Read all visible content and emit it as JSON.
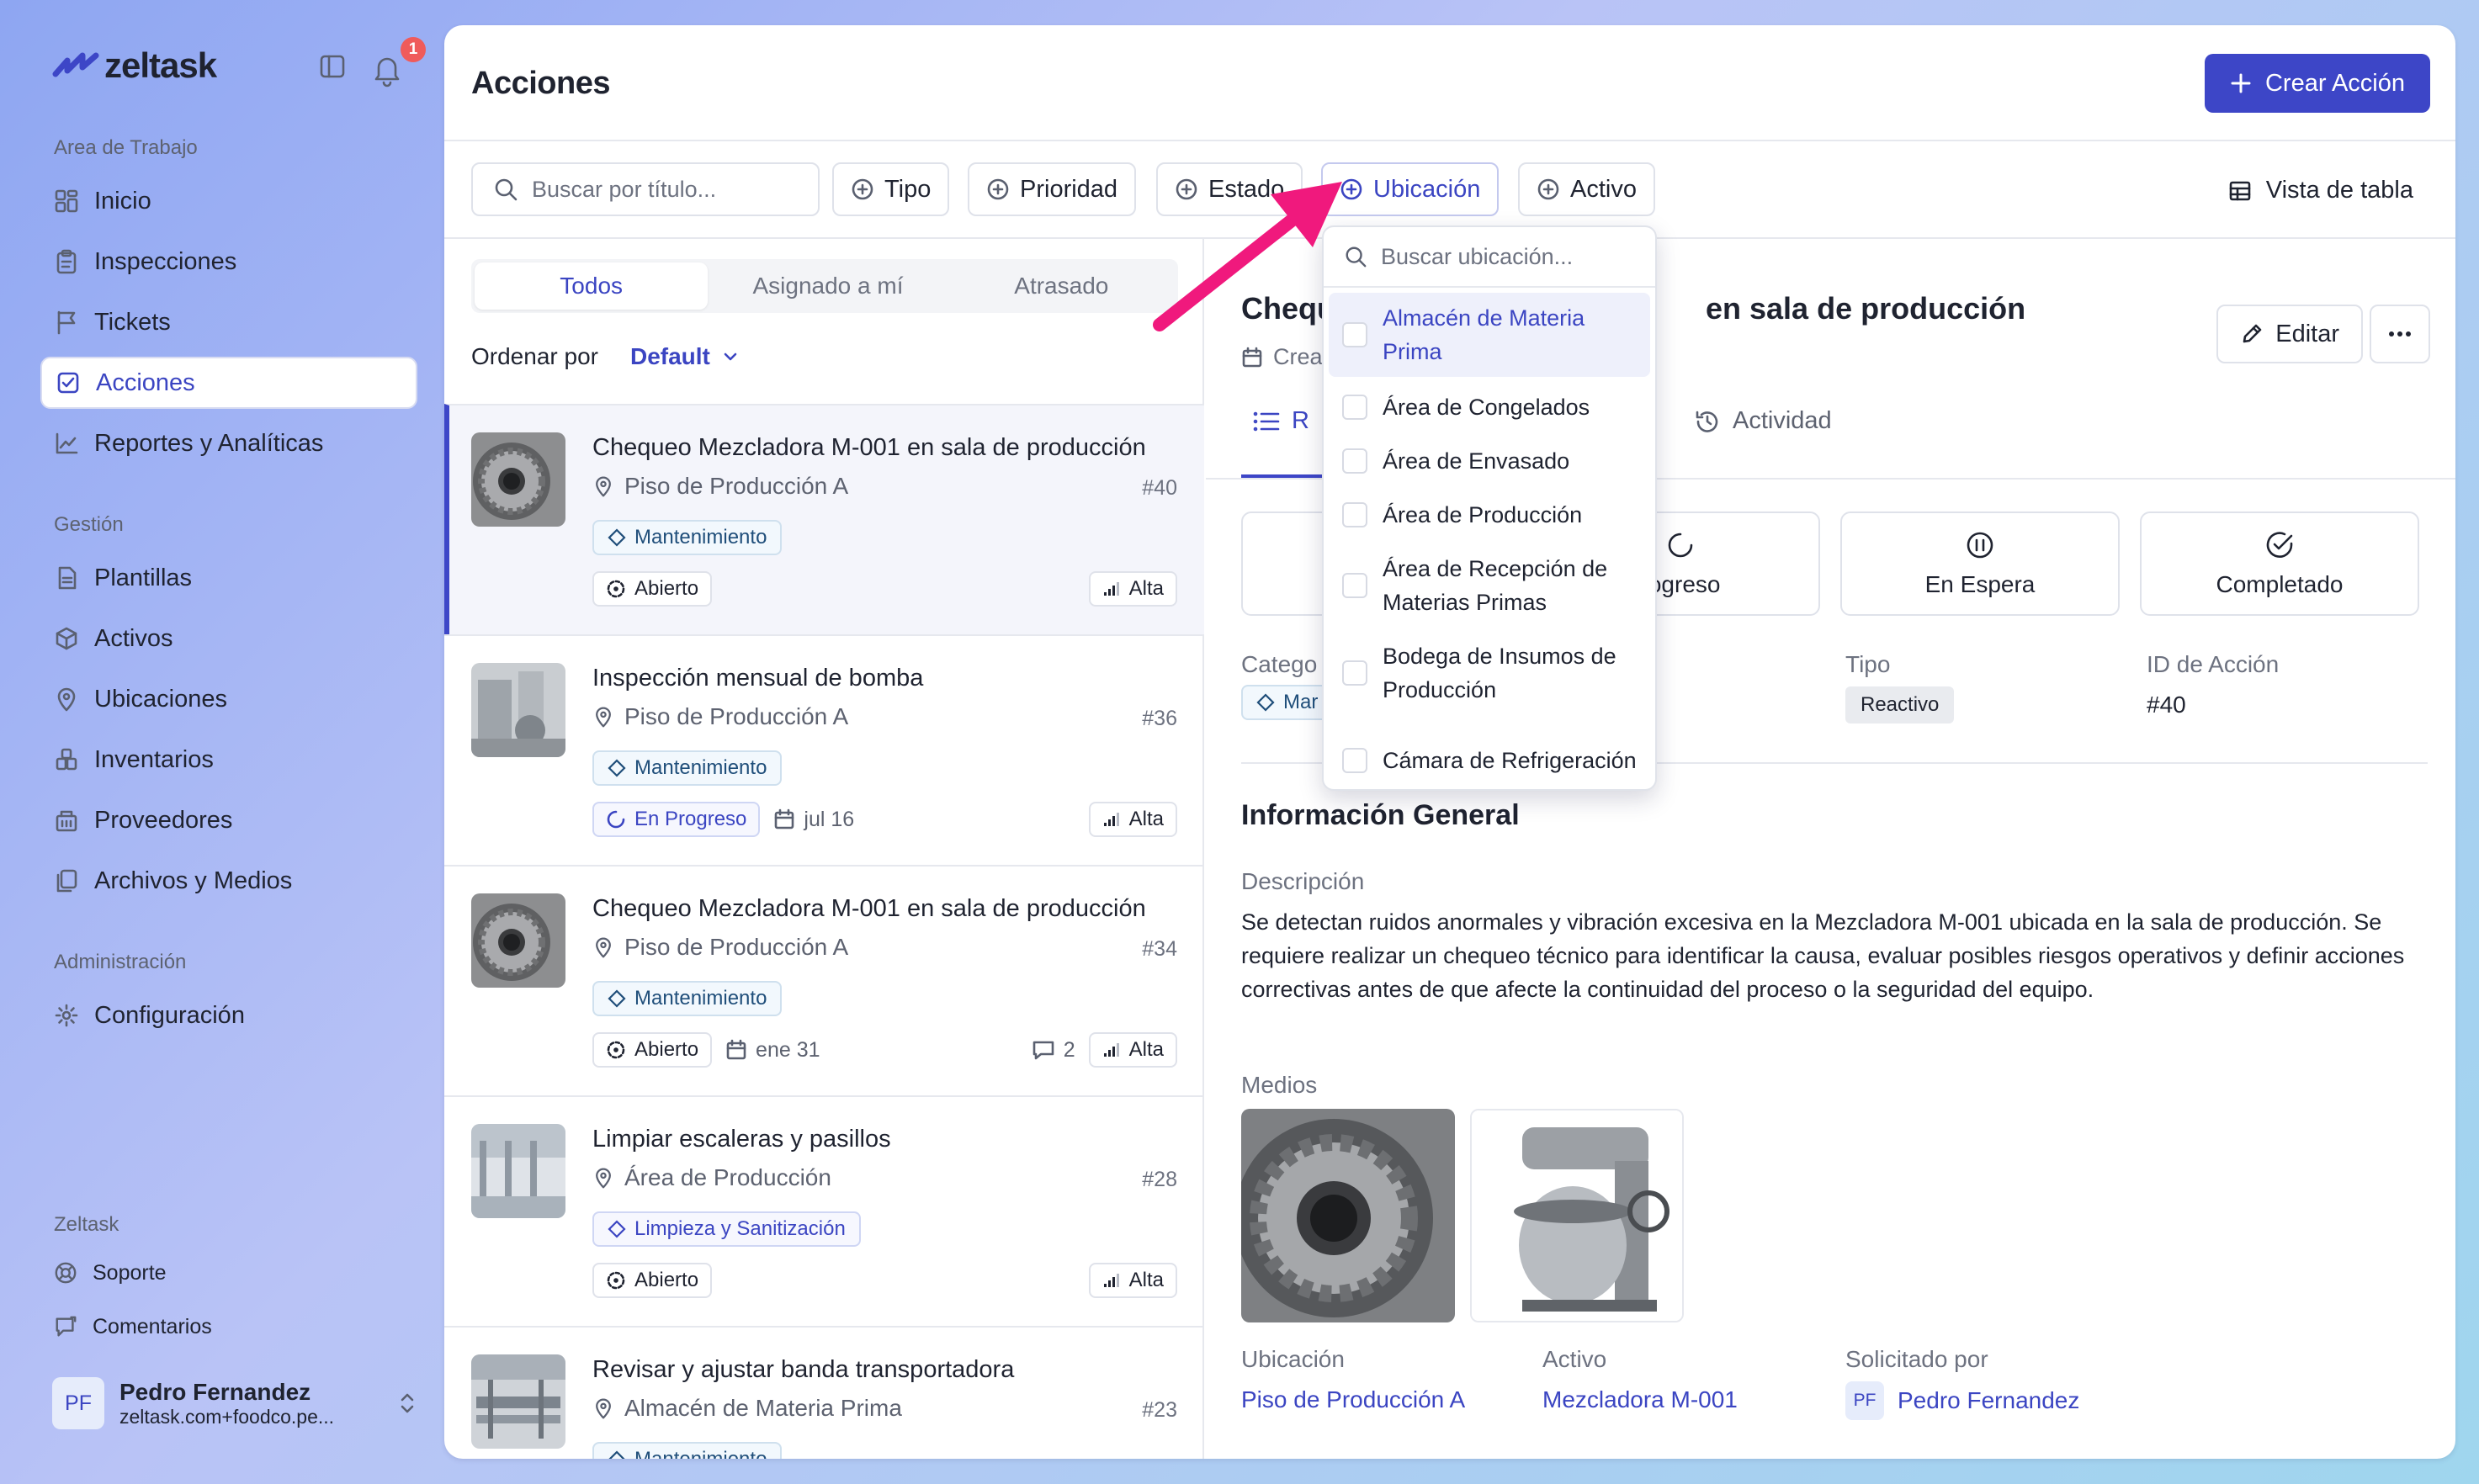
{
  "brand": {
    "name": "zeltask",
    "accent": "#3d46c7",
    "notif_count": "1"
  },
  "sidebar": {
    "section_workspace": "Area de Trabajo",
    "workspace_items": [
      {
        "label": "Inicio",
        "icon": "dashboard-icon"
      },
      {
        "label": "Inspecciones",
        "icon": "clipboard-icon"
      },
      {
        "label": "Tickets",
        "icon": "flag-icon"
      },
      {
        "label": "Acciones",
        "icon": "check-square-icon"
      },
      {
        "label": "Reportes y Analíticas",
        "icon": "chart-line-icon"
      }
    ],
    "section_management": "Gestión",
    "management_items": [
      {
        "label": "Plantillas",
        "icon": "document-icon"
      },
      {
        "label": "Activos",
        "icon": "box-icon"
      },
      {
        "label": "Ubicaciones",
        "icon": "map-pin-icon"
      },
      {
        "label": "Inventarios",
        "icon": "inventory-icon"
      },
      {
        "label": "Proveedores",
        "icon": "building-icon"
      },
      {
        "label": "Archivos y Medios",
        "icon": "files-icon"
      }
    ],
    "section_admin": "Administración",
    "admin_items": [
      {
        "label": "Configuración",
        "icon": "gear-icon"
      }
    ],
    "section_zeltask": "Zeltask",
    "zeltask_items": [
      {
        "label": "Soporte",
        "icon": "lifebuoy-icon"
      },
      {
        "label": "Comentarios",
        "icon": "feedback-icon"
      }
    ],
    "user": {
      "initials": "PF",
      "name": "Pedro Fernandez",
      "email": "zeltask.com+foodco.pe..."
    }
  },
  "header": {
    "title": "Acciones",
    "create_label": "Crear Acción"
  },
  "filters": {
    "search_placeholder": "Buscar por título...",
    "chips": [
      "Tipo",
      "Prioridad",
      "Estado",
      "Ubicación",
      "Activo"
    ],
    "view_label": "Vista de tabla"
  },
  "list": {
    "tabs": [
      "Todos",
      "Asignado a mí",
      "Atrasado"
    ],
    "sort_label": "Ordenar por",
    "sort_value": "Default",
    "items": [
      {
        "title": "Chequeo Mezcladora M-001 en sala de producción",
        "location": "Piso de Producción A",
        "id": "#40",
        "category": "Mantenimiento",
        "status": "Abierto",
        "date": "",
        "comments": "",
        "priority": "Alta"
      },
      {
        "title": "Inspección mensual de bomba",
        "location": "Piso de Producción A",
        "id": "#36",
        "category": "Mantenimiento",
        "status": "En Progreso",
        "date": "jul 16",
        "comments": "",
        "priority": "Alta"
      },
      {
        "title": "Chequeo Mezcladora M-001 en sala de producción",
        "location": "Piso de Producción A",
        "id": "#34",
        "category": "Mantenimiento",
        "status": "Abierto",
        "date": "ene 31",
        "comments": "2",
        "priority": "Alta"
      },
      {
        "title": "Limpiar escaleras y pasillos",
        "location": "Área de Producción",
        "id": "#28",
        "category": "Limpieza y Sanitización",
        "status": "Abierto",
        "date": "",
        "comments": "",
        "priority": "Alta"
      },
      {
        "title": "Revisar y ajustar banda transportadora",
        "location": "Almacén de Materia Prima",
        "id": "#23",
        "category": "Mantenimiento",
        "status": "",
        "date": "",
        "comments": "",
        "priority": ""
      }
    ]
  },
  "detail": {
    "title_start": "Chequ",
    "title_end": "en sala de producción",
    "created_prefix": "Crea",
    "edit_label": "Editar",
    "tabs": [
      "R",
      "Actividad"
    ],
    "status_buttons": [
      "",
      "rogreso",
      "En Espera",
      "Completado"
    ],
    "category_label": "Catego",
    "category_value": "Mar",
    "type_label": "Tipo",
    "type_value": "Reactivo",
    "id_label": "ID de Acción",
    "id_value": "#40",
    "section_title": "Información General",
    "desc_label": "Descripción",
    "description": "Se detectan ruidos anormales y vibración excesiva en la Mezcladora M-001 ubicada en la sala de producción. Se requiere realizar un chequeo técnico para identificar la causa, evaluar posibles riesgos operativos y definir acciones correctivas antes de que afecte la continuidad del proceso o la seguridad del equipo.",
    "media_label": "Medios",
    "location_label": "Ubicación",
    "location_value": "Piso de Producción A",
    "asset_label": "Activo",
    "asset_value": "Mezcladora M-001",
    "requested_label": "Solicitado por",
    "requested_initials": "PF",
    "requested_value": "Pedro Fernandez"
  },
  "dropdown": {
    "search_placeholder": "Buscar ubicación...",
    "options": [
      "Almacén de Materia Prima",
      "Área de Congelados",
      "Área de Envasado",
      "Área de Producción",
      "Área de Recepción de Materias Primas",
      "Bodega de Insumos de Producción",
      "Cámara de Refrigeración"
    ]
  },
  "annotation": {
    "arrow_color": "#f0197d"
  }
}
